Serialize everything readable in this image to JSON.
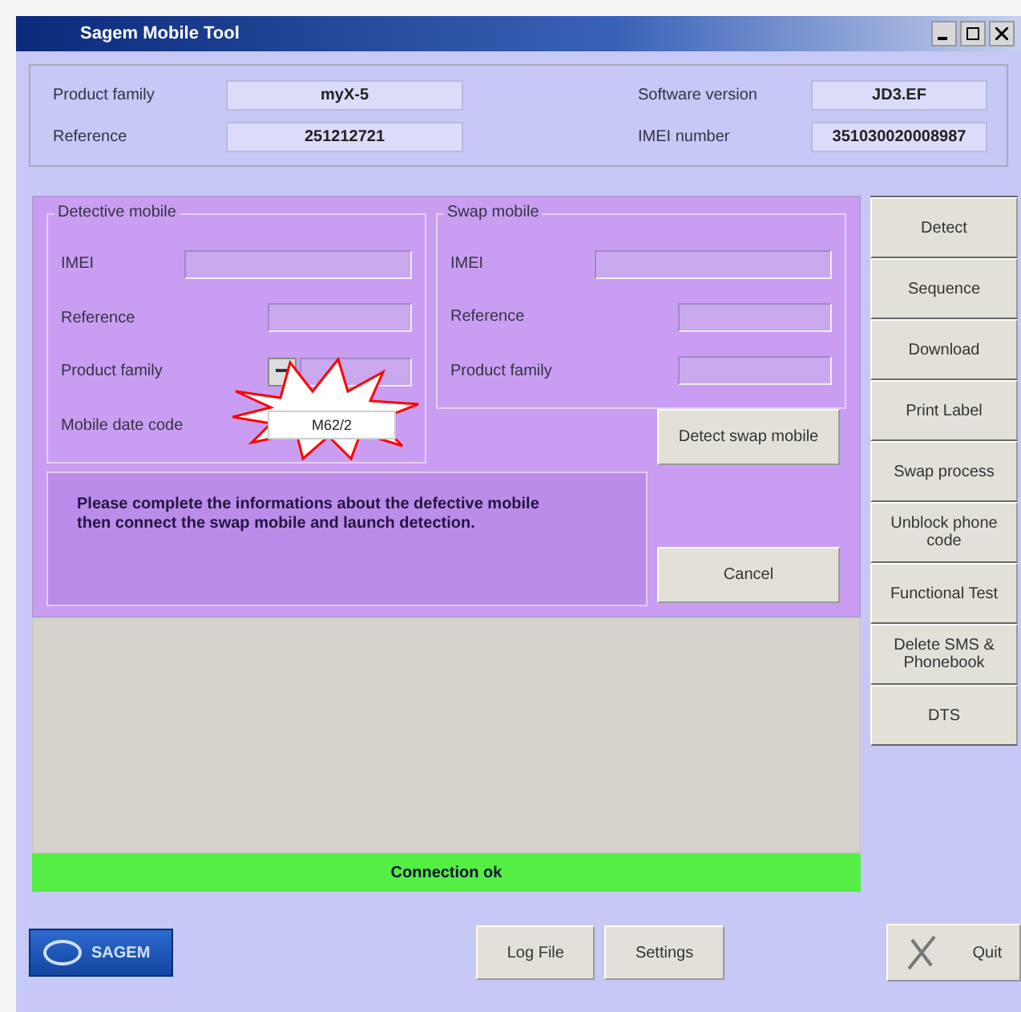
{
  "window": {
    "title": "Sagem Mobile Tool"
  },
  "info": [
    {
      "label": "Product family",
      "value": "myX-5"
    },
    {
      "label": "Software version",
      "value": "JD3.EF"
    },
    {
      "label": "Reference",
      "value": "251212721"
    },
    {
      "label": "IMEI number",
      "value": "351030020008987"
    }
  ],
  "detective_mobile": {
    "title": "Detective mobile",
    "fields": [
      {
        "label": "IMEI",
        "kind": "wide"
      },
      {
        "label": "Reference",
        "kind": "short"
      },
      {
        "label": "Product family",
        "kind": "dropdown"
      },
      {
        "label": "Mobile date code",
        "kind": "value",
        "value": "M62/2",
        "highlighted": true
      }
    ]
  },
  "swap_mobile": {
    "title": "Swap mobile",
    "fields": [
      {
        "label": "IMEI",
        "kind": "wide"
      },
      {
        "label": "Reference",
        "kind": "short"
      },
      {
        "label": "Product family",
        "kind": "short"
      }
    ]
  },
  "message": "Please complete the informations about the defective mobile then connect the swap mobile and launch detection.",
  "panel_buttons": [
    "Detect swap mobile",
    "Cancel"
  ],
  "side_buttons": [
    "Detect",
    "Sequence",
    "Download",
    "Print Label",
    "Swap process",
    "Unblock phone code",
    "Functional Test",
    "Delete SMS & Phonebook",
    "DTS"
  ],
  "status": "Connection ok",
  "logo": {
    "text": "SAGEM"
  },
  "bottom_buttons": [
    "Log File",
    "Settings"
  ],
  "quit_button": "Quit"
}
